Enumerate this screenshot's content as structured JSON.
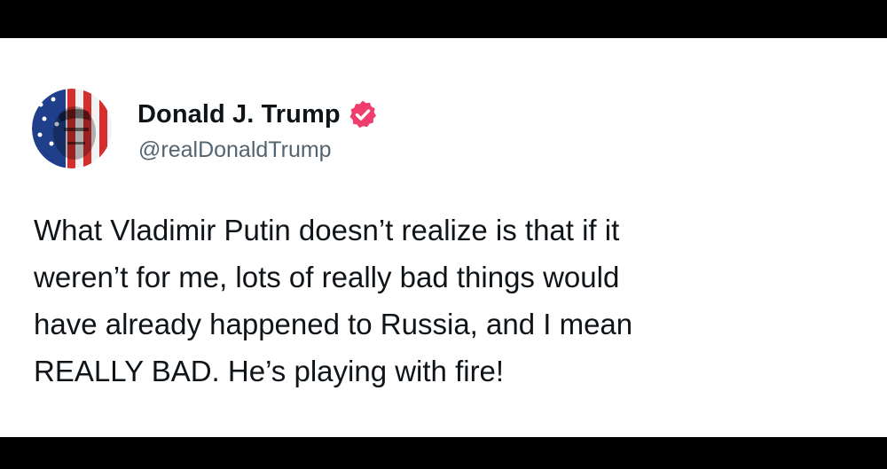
{
  "post": {
    "author": {
      "display_name": "Donald J. Trump",
      "handle": "@realDonaldTrump",
      "verified_icon": "verified-badge-icon",
      "avatar": "flag-portrait-avatar"
    },
    "text": "What Vladimir Putin doesn’t realize is that if it\nweren’t for me, lots of really bad things would\nhave already happened to Russia, and I mean\nREALLY BAD. He’s playing with fire!"
  },
  "colors": {
    "background": "#ffffff",
    "frame": "#000000",
    "text": "#0f1419",
    "handle": "#536471",
    "verified": "#ef3e6e"
  }
}
